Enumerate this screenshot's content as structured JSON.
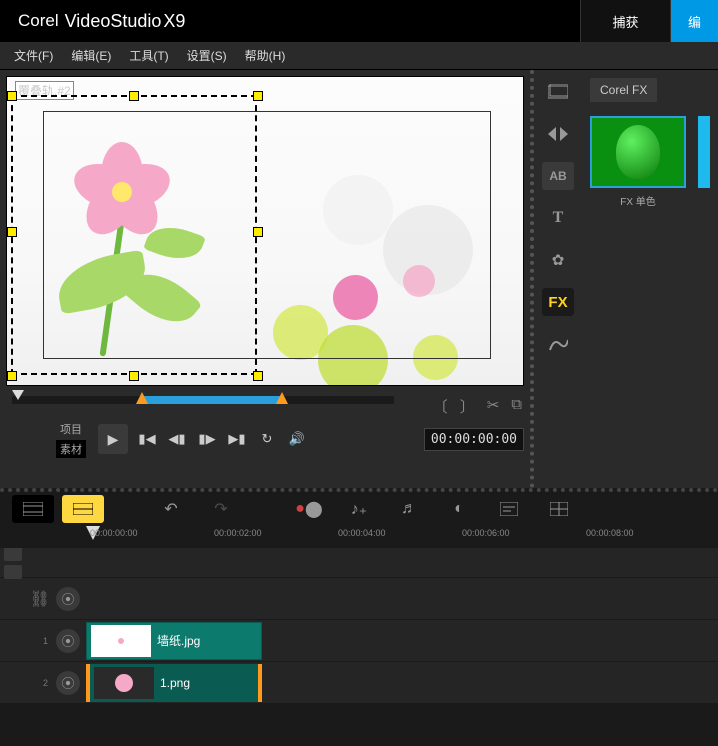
{
  "app": {
    "brand": "Corel",
    "product": "VideoStudio",
    "version": "X9"
  },
  "titleTabs": {
    "capture": "捕获",
    "edit": "编"
  },
  "menu": {
    "file": "文件(F)",
    "edit": "编辑(E)",
    "tools": "工具(T)",
    "settings": "设置(S)",
    "help": "帮助(H)"
  },
  "preview": {
    "overlayLabel": "覆叠轨.#2",
    "timecode": "00:00:00:00",
    "modeProject": "项目",
    "modeClip": "素材"
  },
  "library": {
    "tab": "Corel FX",
    "fxItem1": "FX 单色",
    "iconFX": "FX",
    "iconAB": "AB",
    "iconT": "T"
  },
  "ruler": {
    "t0": "00:00:00:00",
    "t2": "00:00:02:00",
    "t4": "00:00:04:00",
    "t6": "00:00:06:00",
    "t8": "00:00:08:00"
  },
  "clips": {
    "wall": "墙纸.jpg",
    "png": "1.png"
  }
}
